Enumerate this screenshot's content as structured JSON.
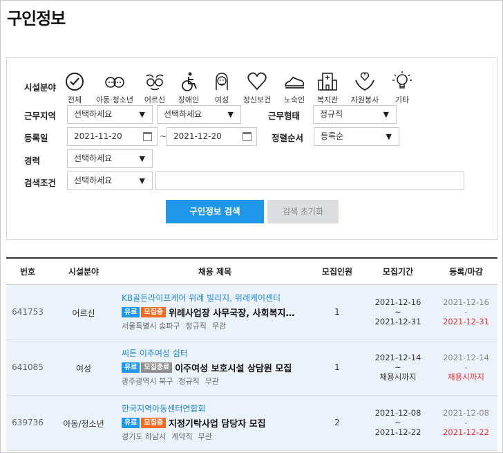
{
  "page": {
    "title": "구인정보"
  },
  "filters": {
    "facility_label": "시설분야",
    "categories": [
      {
        "label": "전체",
        "icon": "check-circle-icon"
      },
      {
        "label": "아동·청소년",
        "icon": "children-icon"
      },
      {
        "label": "어르신",
        "icon": "elderly-glasses-icon"
      },
      {
        "label": "장애인",
        "icon": "wheelchair-icon"
      },
      {
        "label": "여성",
        "icon": "woman-icon"
      },
      {
        "label": "정신보건",
        "icon": "heart-icon"
      },
      {
        "label": "노숙인",
        "icon": "shoe-icon"
      },
      {
        "label": "복지관",
        "icon": "building-icon"
      },
      {
        "label": "자원봉사",
        "icon": "hands-heart-icon"
      },
      {
        "label": "기타",
        "icon": "lightbulb-icon"
      }
    ],
    "region_label": "근무지역",
    "region1": "선택하세요",
    "region2": "선택하세요",
    "worktype_label": "근무형태",
    "worktype": "정규직",
    "regdate_label": "등록일",
    "date_from": "2021-11-20",
    "date_sep": "~",
    "date_to": "2021-12-20",
    "sort_label": "정렬순서",
    "sort": "등록순",
    "career_label": "경력",
    "career": "선택하세요",
    "condition_label": "검색조건",
    "condition": "선택하세요",
    "keyword": ""
  },
  "buttons": {
    "search": "구인정보 검색",
    "reset": "검색 초기화"
  },
  "table": {
    "headers": [
      "번호",
      "시설분야",
      "채용 제목",
      "모집인원",
      "모집기간",
      "등록/마감"
    ],
    "rows": [
      {
        "num": "641753",
        "field": "어르신",
        "org": "KB골든라이프케어 위례 빌리지, 위례케어센터",
        "badge1": "유료",
        "badge2": "모집중",
        "title": "위례사업장 사무국장, 사회복지…",
        "location": "서울특별시 송파구",
        "type": "정규직",
        "career": "무관",
        "count": "1",
        "period_start": "2021-12-16",
        "period_sep": "~",
        "period_end": "2021-12-31",
        "reg_date": "2021-12-16",
        "reg_sep": "-",
        "deadline": "2021-12-31"
      },
      {
        "num": "641085",
        "field": "여성",
        "org": "씨튼 이주여성 쉼터",
        "badge1": "유료",
        "badge2": "모집종료",
        "title": "이주여성 보호시설 상담원 모집",
        "location": "광주광역시 북구",
        "type": "정규직",
        "career": "무관",
        "count": "1",
        "period_start": "2021-12-14",
        "period_sep": "~",
        "period_end": "채용시까지",
        "reg_date": "2021-12-14",
        "reg_sep": "-",
        "deadline": "채용시까지"
      },
      {
        "num": "639736",
        "field": "아동/청소년",
        "org": "한국지역아동센터연합회",
        "badge1": "유료",
        "badge2": "모집중",
        "title": "지정기탁사업 담당자 모집",
        "location": "경기도 하남시",
        "type": "계약직",
        "career": "무관",
        "count": "2",
        "period_start": "2021-12-08",
        "period_sep": "~",
        "period_end": "2021-12-22",
        "reg_date": "2021-12-08",
        "reg_sep": "-",
        "deadline": "2021-12-22"
      }
    ]
  }
}
